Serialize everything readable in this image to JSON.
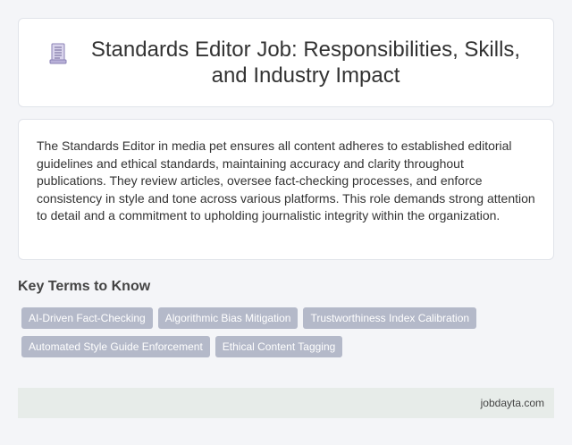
{
  "header": {
    "icon": "document-icon",
    "title": "Standards Editor Job: Responsibilities, Skills, and Industry Impact"
  },
  "main": {
    "description": "The Standards Editor in media pet ensures all content adheres to established editorial guidelines and ethical standards, maintaining accuracy and clarity throughout publications. They review articles, oversee fact-checking processes, and enforce consistency in style and tone across various platforms. This role demands strong attention to detail and a commitment to upholding journalistic integrity within the organization."
  },
  "key_terms": {
    "title": "Key Terms to Know",
    "tags": [
      "AI-Driven Fact-Checking",
      "Algorithmic Bias Mitigation",
      "Trustworthiness Index Calibration",
      "Automated Style Guide Enforcement",
      "Ethical Content Tagging"
    ]
  },
  "footer": {
    "site": "jobdayta.com"
  },
  "colors": {
    "background": "#f4f5f8",
    "card": "#ffffff",
    "tag": "#b4b9c9",
    "footer": "#e7ece9"
  }
}
